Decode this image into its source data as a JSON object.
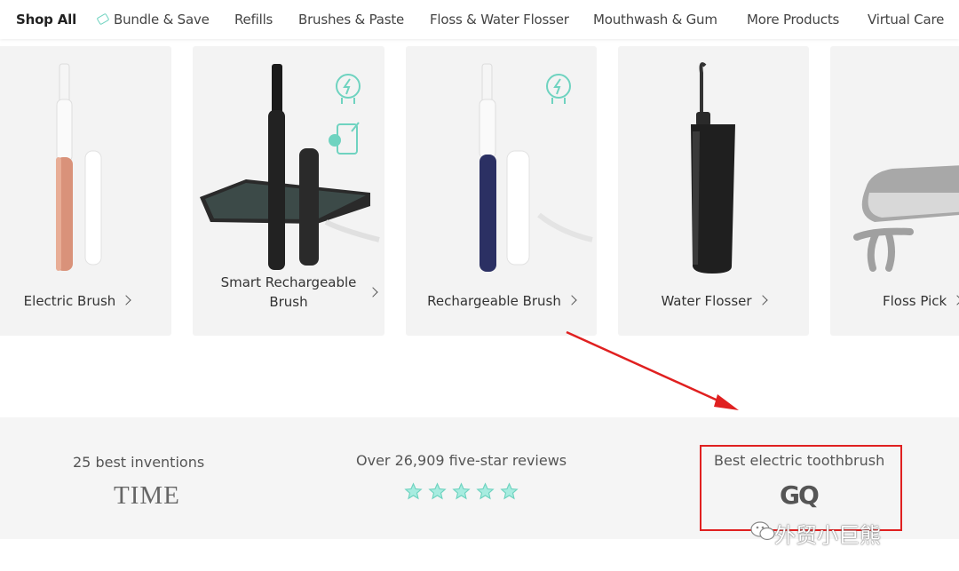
{
  "nav": {
    "items": [
      {
        "label": "Shop All",
        "active": true
      },
      {
        "label": "Bundle & Save",
        "icon": "tag-icon"
      },
      {
        "label": "Refills"
      },
      {
        "label": "Brushes & Paste"
      },
      {
        "label": "Floss & Water Flosser"
      },
      {
        "label": "Mouthwash & Gum"
      },
      {
        "label": "More Products"
      },
      {
        "label": "Virtual Care"
      }
    ]
  },
  "products": [
    {
      "label": "Electric Brush",
      "color": "#d9927a"
    },
    {
      "label_line1": "Smart Rechargeable",
      "label_line2": "Brush",
      "color": "#1f1f1f",
      "icons": [
        "bolt-icon",
        "phone-bluetooth-icon"
      ]
    },
    {
      "label": "Rechargeable Brush",
      "color": "#2b3063",
      "icons": [
        "bolt-icon"
      ]
    },
    {
      "label": "Water Flosser",
      "color": "#222222"
    },
    {
      "label": "Floss Pick",
      "color": "#999999"
    }
  ],
  "press": {
    "time_caption": "25 best inventions",
    "time_logo": "TIME",
    "reviews_caption": "Over 26,909 five-star reviews",
    "stars": 5,
    "gq_caption": "Best electric toothbrush",
    "gq_logo": "GQ"
  },
  "watermark": "外贸小巨熊",
  "colors": {
    "accent": "#6fd3c0",
    "annotation": "#e02020"
  }
}
